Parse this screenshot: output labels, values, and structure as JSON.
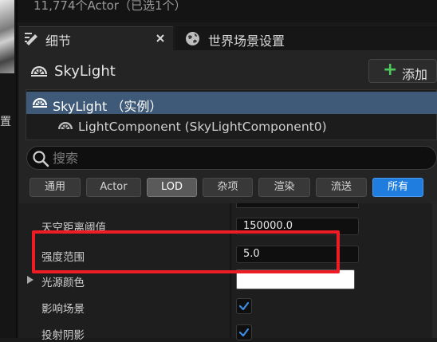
{
  "actor_count": "11,774个Actor（已选1个）",
  "tabs": [
    {
      "label": "细节",
      "icon": "details-icon",
      "closable": true
    },
    {
      "label": "世界场景设置",
      "icon": "globe-icon"
    }
  ],
  "left_strip": {
    "label": "置"
  },
  "details": {
    "actor_name": "SkyLight",
    "add_button": "添加",
    "tree": {
      "instance": "SkyLight （实例）",
      "component": "LightComponent (SkyLightComponent0)"
    },
    "search": {
      "placeholder": "搜索",
      "value": ""
    },
    "filters": [
      "通用",
      "Actor",
      "LOD",
      "杂项",
      "渲染",
      "流送",
      "所有"
    ],
    "selected_filter": "所有",
    "properties": [
      {
        "label": "天空距离阈值",
        "value": "150000.0",
        "type": "number"
      },
      {
        "label": "强度范围",
        "value": "5.0",
        "type": "number"
      },
      {
        "label": "光源颜色",
        "value": "#FFFFFF",
        "type": "color"
      },
      {
        "label": "影响场景",
        "checked": true,
        "type": "checkbox"
      },
      {
        "label": "投射阴影",
        "checked": true,
        "type": "checkbox"
      }
    ]
  },
  "colors": {
    "accent": "#1F7DE0",
    "highlight": "#EE1C25",
    "add_plus": "#4FC95A",
    "selection": "#3E5A78"
  }
}
